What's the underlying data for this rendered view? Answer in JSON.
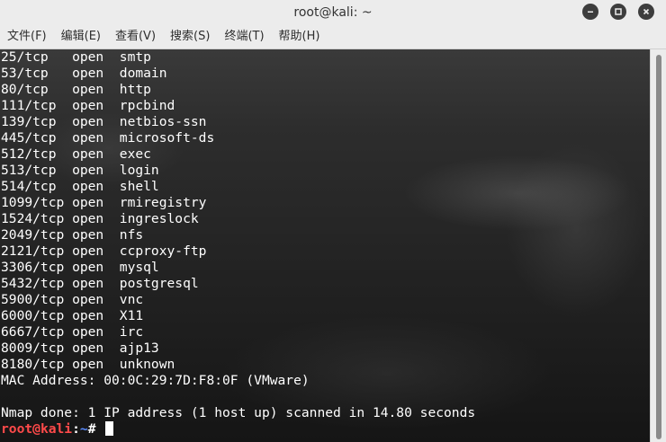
{
  "window": {
    "title": "root@kali: ~"
  },
  "menu": {
    "items": [
      {
        "label": "文件(F)"
      },
      {
        "label": "编辑(E)"
      },
      {
        "label": "查看(V)"
      },
      {
        "label": "搜索(S)"
      },
      {
        "label": "终端(T)"
      },
      {
        "label": "帮助(H)"
      }
    ]
  },
  "terminal": {
    "lines": [
      "25/tcp   open  smtp",
      "53/tcp   open  domain",
      "80/tcp   open  http",
      "111/tcp  open  rpcbind",
      "139/tcp  open  netbios-ssn",
      "445/tcp  open  microsoft-ds",
      "512/tcp  open  exec",
      "513/tcp  open  login",
      "514/tcp  open  shell",
      "1099/tcp open  rmiregistry",
      "1524/tcp open  ingreslock",
      "2049/tcp open  nfs",
      "2121/tcp open  ccproxy-ftp",
      "3306/tcp open  mysql",
      "5432/tcp open  postgresql",
      "5900/tcp open  vnc",
      "6000/tcp open  X11",
      "6667/tcp open  irc",
      "8009/tcp open  ajp13",
      "8180/tcp open  unknown",
      "MAC Address: 00:0C:29:7D:F8:0F (VMware)",
      "",
      "Nmap done: 1 IP address (1 host up) scanned in 14.80 seconds"
    ],
    "prompt": {
      "user": "root",
      "at": "@",
      "host": "kali",
      "sep": ":",
      "path": "~",
      "symbol": "# "
    }
  },
  "colors": {
    "prompt_user": "#ff4a4a",
    "prompt_path": "#5a8cff",
    "terminal_text": "#ffffff",
    "chrome_bg": "#ececec"
  }
}
